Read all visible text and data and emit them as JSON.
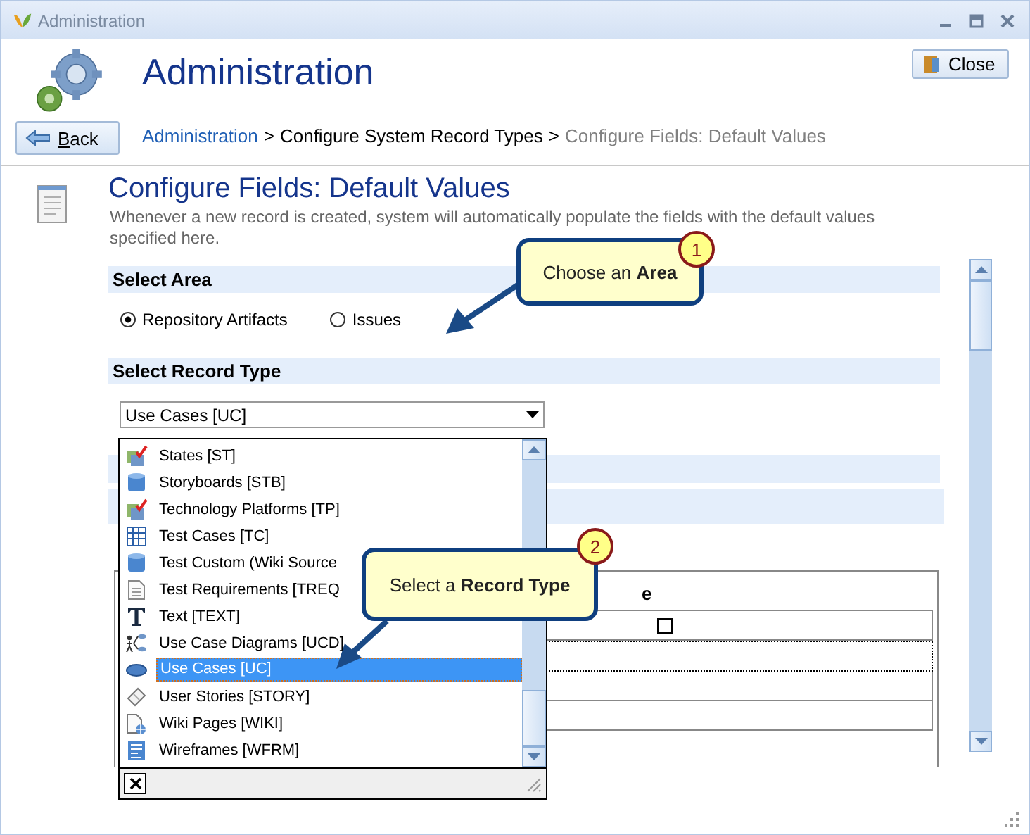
{
  "window": {
    "title": "Administration"
  },
  "header": {
    "title": "Administration",
    "close_button": "Close",
    "back_button": "Back",
    "breadcrumb": [
      {
        "kind": "link",
        "label": "Administration"
      },
      {
        "kind": "separator",
        "label": ">"
      },
      {
        "kind": "text",
        "label": "Configure System Record Types"
      },
      {
        "kind": "separator",
        "label": ">"
      },
      {
        "kind": "current",
        "label": "Configure Fields: Default Values"
      }
    ]
  },
  "page": {
    "title": "Configure Fields: Default Values",
    "description": "Whenever a new record is created, system will automatically populate the fields with the default values specified here."
  },
  "area": {
    "heading": "Select Area",
    "options": [
      {
        "label": "Repository Artifacts",
        "selected": true
      },
      {
        "label": "Issues",
        "selected": false
      }
    ]
  },
  "record_type": {
    "heading": "Select Record Type",
    "value": "Use Cases [UC]",
    "dropdown": [
      {
        "label": "States [ST]",
        "kind": "state",
        "selected": false
      },
      {
        "label": "Storyboards [STB]",
        "kind": "database",
        "selected": false
      },
      {
        "label": "Technology Platforms [TP]",
        "kind": "state",
        "selected": false
      },
      {
        "label": "Test Cases [TC]",
        "kind": "grid",
        "selected": false
      },
      {
        "label": "Test Custom (Wiki Source",
        "kind": "database",
        "selected": false
      },
      {
        "label": "Test Requirements [TREQ",
        "kind": "document",
        "selected": false
      },
      {
        "label": "Text [TEXT]",
        "kind": "text",
        "selected": false
      },
      {
        "label": "Use Case Diagrams [UCD]",
        "kind": "diagram",
        "selected": false
      },
      {
        "label": "Use Cases [UC]",
        "kind": "ellipse",
        "selected": true
      },
      {
        "label": "User Stories [STORY]",
        "kind": "story",
        "selected": false
      },
      {
        "label": "Wiki Pages [WIKI]",
        "kind": "wiki",
        "selected": false
      },
      {
        "label": "Wireframes [WFRM]",
        "kind": "wireframe",
        "selected": false
      }
    ]
  },
  "table": {
    "column": "e",
    "rows": [
      {
        "kind": "checkbox",
        "checked": false,
        "focused": false
      },
      {
        "kind": "empty",
        "focused": true
      },
      {
        "kind": "empty",
        "focused": false
      },
      {
        "kind": "empty",
        "focused": false
      }
    ]
  },
  "callouts": [
    {
      "number": "1",
      "text": "Choose an **Area**"
    },
    {
      "number": "2",
      "text": "Select a **Record Type**"
    }
  ]
}
